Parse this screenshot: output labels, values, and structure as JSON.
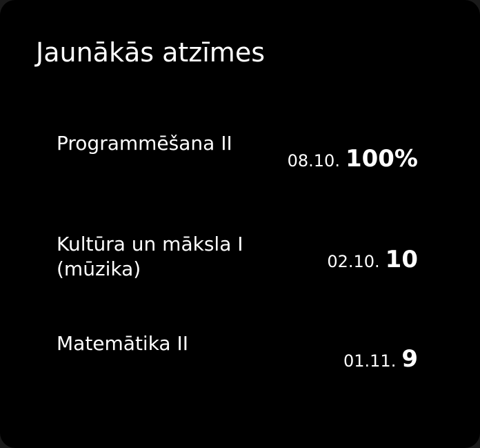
{
  "widget": {
    "title": "Jaunākās atzīmes",
    "grades": [
      {
        "subject": "Programmēšana II",
        "date": "08.10.",
        "grade": "100%"
      },
      {
        "subject": "Kultūra un māksla I (mūzika)",
        "date": "02.10.",
        "grade": "10"
      },
      {
        "subject": "Matemātika II",
        "date": "01.11.",
        "grade": "9"
      }
    ]
  },
  "colors": {
    "background": "#000000",
    "text": "#ffffff"
  }
}
